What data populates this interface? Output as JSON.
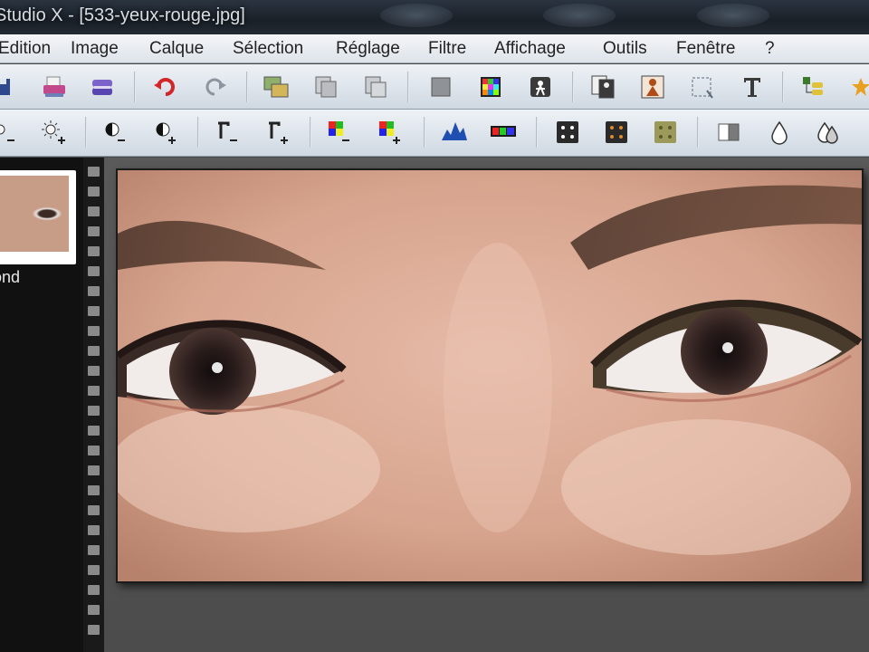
{
  "window": {
    "title": "Studio X - [533-yeux-rouge.jpg]"
  },
  "menu": {
    "items": [
      "Edition",
      "Image",
      "Calque",
      "Sélection",
      "Réglage",
      "Filtre",
      "Affichage",
      "Outils",
      "Fenêtre",
      "?"
    ]
  },
  "toolbar1": {
    "buttons": [
      "save-icon",
      "print-icon",
      "scan-icon",
      "undo-icon",
      "redo-icon",
      "import-icon",
      "copy-icon",
      "paste-icon",
      "layer-icon",
      "palette-icon",
      "effect-icon",
      "frame-icon",
      "person-icon",
      "crop-selection-icon",
      "text-tool-icon",
      "layers-stack-icon",
      "star-icon"
    ]
  },
  "toolbar2": {
    "buttons": [
      "brightness-down-icon",
      "brightness-up-icon",
      "contrast-down-icon",
      "contrast-up-icon",
      "gamma-down-icon",
      "gamma-up-icon",
      "saturation-down-icon",
      "saturation-up-icon",
      "histogram-icon",
      "histogram-rgb-icon",
      "levels-dark-icon",
      "levels-brown-icon",
      "levels-olive-icon",
      "invert-icon",
      "drop-icon",
      "drops-icon"
    ]
  },
  "layers": {
    "layer_name": "ond"
  },
  "colors": {
    "menubar": "#e8ecf0",
    "toolbar": "#dde4ec",
    "workspace": "#525252",
    "filmstrip": "#111111"
  }
}
